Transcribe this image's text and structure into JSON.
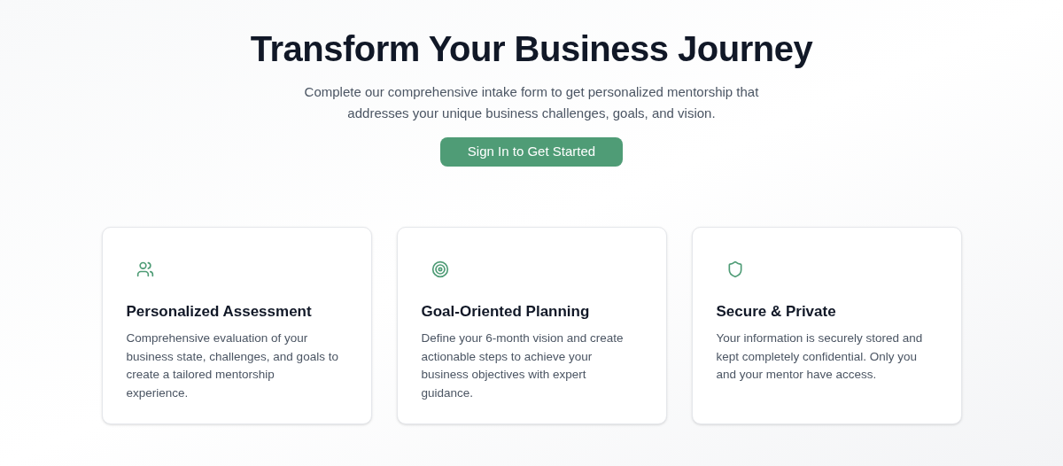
{
  "hero": {
    "title": "Transform Your Business Journey",
    "subtitle": "Complete our comprehensive intake form to get personalized mentorship that addresses your unique business challenges, goals, and vision.",
    "button": "Sign In to Get Started"
  },
  "features": [
    {
      "kind": "users",
      "title": "Personalized Assessment",
      "description": "Comprehensive evaluation of your business state, challenges, and goals to create a tailored mentorship experience."
    },
    {
      "kind": "target",
      "title": "Goal-Oriented Planning",
      "description": "Define your 6-month vision and create actionable steps to achieve your business objectives with expert guidance."
    },
    {
      "kind": "shield",
      "title": "Secure & Private",
      "description": "Your information is securely stored and kept completely confidential. Only you and your mentor have access."
    }
  ]
}
